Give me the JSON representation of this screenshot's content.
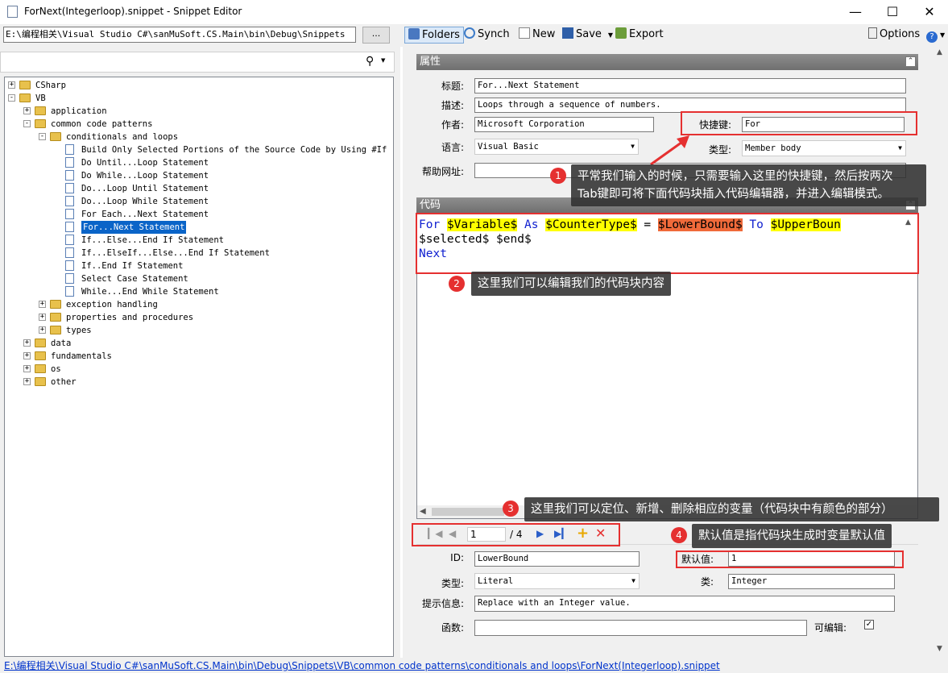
{
  "window": {
    "title": "ForNext(Integerloop).snippet - Snippet Editor"
  },
  "path": {
    "value": "E:\\编程相关\\Visual Studio C#\\sanMuSoft.CS.Main\\bin\\Debug\\Snippets",
    "browse_label": "..."
  },
  "toolbar": {
    "folders": "Folders",
    "synch": "Synch",
    "new": "New",
    "save": "Save",
    "export": "Export",
    "options": "Options"
  },
  "tree": [
    {
      "label": "CSharp"
    },
    {
      "label": "VB"
    },
    {
      "label": "application"
    },
    {
      "label": "common code patterns"
    },
    {
      "label": "conditionals and loops"
    },
    {
      "label": "Build Only Selected Portions of the Source Code by Using #If"
    },
    {
      "label": "Do Until...Loop Statement"
    },
    {
      "label": "Do While...Loop Statement"
    },
    {
      "label": "Do...Loop Until Statement"
    },
    {
      "label": "Do...Loop While Statement"
    },
    {
      "label": "For Each...Next Statement"
    },
    {
      "label": "For...Next Statement"
    },
    {
      "label": "If...Else...End If Statement"
    },
    {
      "label": "If...ElseIf...Else...End If Statement"
    },
    {
      "label": "If..End If Statement"
    },
    {
      "label": "Select Case Statement"
    },
    {
      "label": "While...End While Statement"
    },
    {
      "label": "exception handling"
    },
    {
      "label": "properties and procedures"
    },
    {
      "label": "types"
    },
    {
      "label": "data"
    },
    {
      "label": "fundamentals"
    },
    {
      "label": "os"
    },
    {
      "label": "other"
    }
  ],
  "props": {
    "header": "属性",
    "title_label": "标题:",
    "title_value": "For...Next Statement",
    "desc_label": "描述:",
    "desc_value": "Loops through a sequence of numbers.",
    "author_label": "作者:",
    "author_value": "Microsoft Corporation",
    "shortcut_label": "快捷键:",
    "shortcut_value": "For",
    "lang_label": "语言:",
    "lang_value": "Visual Basic",
    "type_label": "类型:",
    "type_value": "Member body",
    "help_label": "帮助网址:",
    "help_value": ""
  },
  "code": {
    "header": "代码",
    "line1": [
      {
        "t": "For",
        "c": "kw"
      },
      {
        "t": " ",
        "c": ""
      },
      {
        "t": "$Variable$",
        "c": "var"
      },
      {
        "t": " ",
        "c": ""
      },
      {
        "t": "As",
        "c": "kw"
      },
      {
        "t": " ",
        "c": ""
      },
      {
        "t": "$CounterType$",
        "c": "var"
      },
      {
        "t": " = ",
        "c": ""
      },
      {
        "t": "$LowerBound$",
        "c": "varsel"
      },
      {
        "t": " ",
        "c": ""
      },
      {
        "t": "To",
        "c": "kw"
      },
      {
        "t": " ",
        "c": ""
      },
      {
        "t": "$UpperBoun",
        "c": "var"
      }
    ],
    "line2": "$selected$ $end$",
    "line3": "Next"
  },
  "nav": {
    "position": "1",
    "total": "/ 4"
  },
  "vars": {
    "id_label": "ID:",
    "id_value": "LowerBound",
    "default_label": "默认值:",
    "default_value": "1",
    "type_label": "类型:",
    "type_value": "Literal",
    "class_label": "类:",
    "class_value": "Integer",
    "tip_label": "提示信息:",
    "tip_value": "Replace with an Integer value.",
    "func_label": "函数:",
    "func_value": "",
    "editable_label": "可编辑:"
  },
  "callouts": {
    "c1_num": "1",
    "c1_line1": "平常我们输入的时候，只需要输入这里的快捷键，然后按两次",
    "c1_line2": "Tab键即可将下面代码块插入代码编辑器，并进入编辑模式。",
    "c2_num": "2",
    "c2_text": "这里我们可以编辑我们的代码块内容",
    "c3_num": "3",
    "c3_text": "这里我们可以定位、新增、删除相应的变量（代码块中有颜色的部分）",
    "c4_num": "4",
    "c4_text": "默认值是指代码块生成时变量默认值"
  },
  "status": {
    "path": "E:\\编程相关\\Visual Studio C#\\sanMuSoft.CS.Main\\bin\\Debug\\Snippets\\VB\\common code patterns\\conditionals and loops\\ForNext(Integerloop).snippet"
  },
  "colors": {
    "accent": "#e53030",
    "selection": "#0a64c8",
    "keyword": "#1020d0",
    "variable": "#ffff00",
    "active_variable": "#f06a3a"
  }
}
